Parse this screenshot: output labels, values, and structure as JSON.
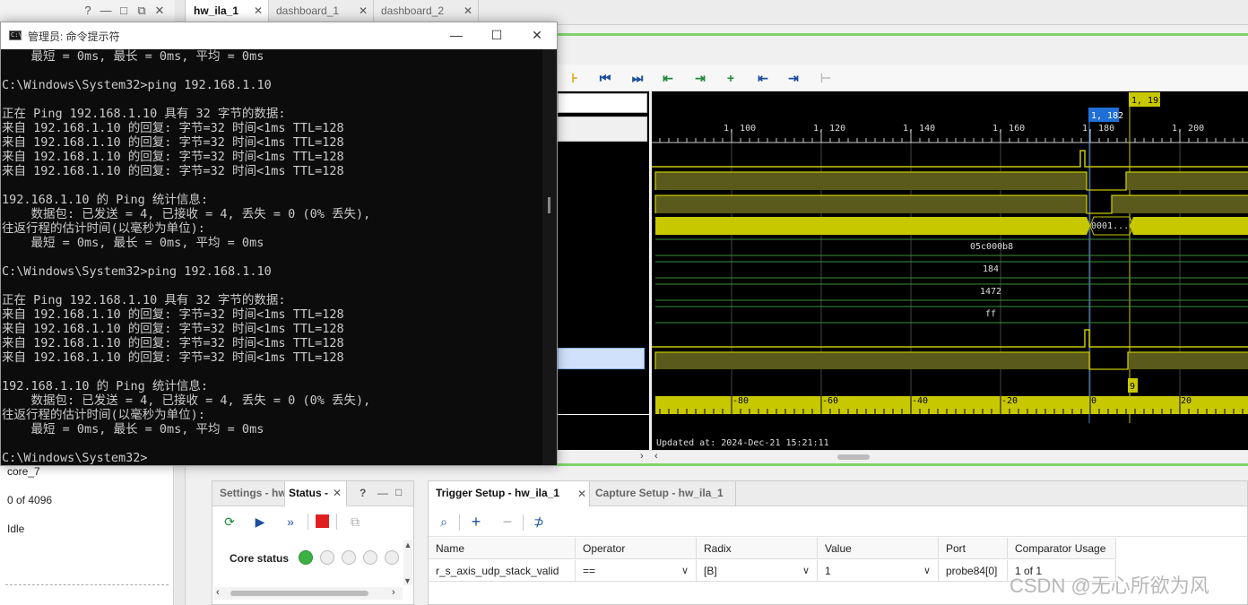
{
  "left_panel": {
    "core_name": "core_7",
    "sample_count": "0 of 4096",
    "state": "Idle",
    "controls": [
      "?",
      "—",
      "□",
      "⧉",
      "✕"
    ]
  },
  "tabs": [
    {
      "label": "hw_ila_1",
      "active": true
    },
    {
      "label": "dashboard_1",
      "active": false
    },
    {
      "label": "dashboard_2",
      "active": false
    }
  ],
  "cmd": {
    "title": "管理员: 命令提示符",
    "icon_text": "C:\\",
    "lines": [
      "    最短 = 0ms, 最长 = 0ms, 平均 = 0ms",
      "",
      "C:\\Windows\\System32>ping 192.168.1.10",
      "",
      "正在 Ping 192.168.1.10 具有 32 字节的数据:",
      "来自 192.168.1.10 的回复: 字节=32 时间<1ms TTL=128",
      "来自 192.168.1.10 的回复: 字节=32 时间<1ms TTL=128",
      "来自 192.168.1.10 的回复: 字节=32 时间<1ms TTL=128",
      "来自 192.168.1.10 的回复: 字节=32 时间<1ms TTL=128",
      "",
      "192.168.1.10 的 Ping 统计信息:",
      "    数据包: 已发送 = 4, 已接收 = 4, 丢失 = 0 (0% 丢失),",
      "往返行程的估计时间(以毫秒为单位):",
      "    最短 = 0ms, 最长 = 0ms, 平均 = 0ms",
      "",
      "C:\\Windows\\System32>ping 192.168.1.10",
      "",
      "正在 Ping 192.168.1.10 具有 32 字节的数据:",
      "来自 192.168.1.10 的回复: 字节=32 时间<1ms TTL=128",
      "来自 192.168.1.10 的回复: 字节=32 时间<1ms TTL=128",
      "来自 192.168.1.10 的回复: 字节=32 时间<1ms TTL=128",
      "来自 192.168.1.10 的回复: 字节=32 时间<1ms TTL=128",
      "",
      "192.168.1.10 的 Ping 统计信息:",
      "    数据包: 已发送 = 4, 已接收 = 4, 丢失 = 0 (0% 丢失),",
      "往返行程的估计时间(以毫秒为单位):",
      "    最短 = 0ms, 最长 = 0ms, 平均 = 0ms",
      "",
      "C:\\Windows\\System32>"
    ]
  },
  "waveform": {
    "top_ticks": [
      "1, 100",
      "1, 120",
      "1, 140",
      "1, 160",
      "1, 180",
      "1, 200"
    ],
    "cursor_blue": "1, 182",
    "cursor_yellow": "1, 191",
    "bus_value_short": "0001...",
    "values": [
      "05c000b8",
      "184",
      "1472",
      "ff"
    ],
    "marker_delta": "9",
    "bottom_ticks": [
      "-80",
      "-60",
      "-40",
      "-20",
      "0",
      "20"
    ],
    "updated": "Updated at: 2024-Dec-21 15:21:11",
    "bg_color": "#000000",
    "signal_color": "#c8c800"
  },
  "status_panel": {
    "tab_settings": "Settings - hw",
    "tab_status": "Status -",
    "core_status_label": "Core status",
    "controls": [
      "?",
      "—",
      "□"
    ]
  },
  "trigger_panel": {
    "tab_trigger": "Trigger Setup - hw_ila_1",
    "tab_capture": "Capture Setup - hw_ila_1",
    "columns": [
      "Name",
      "Operator",
      "Radix",
      "Value",
      "Port",
      "Comparator Usage"
    ],
    "row": {
      "name": "r_s_axis_udp_stack_valid",
      "operator": "==",
      "radix": "[B]",
      "value": "1",
      "port": "probe84[0]",
      "usage": "1 of 1"
    }
  },
  "watermark": "CSDN @无心所欲为风"
}
